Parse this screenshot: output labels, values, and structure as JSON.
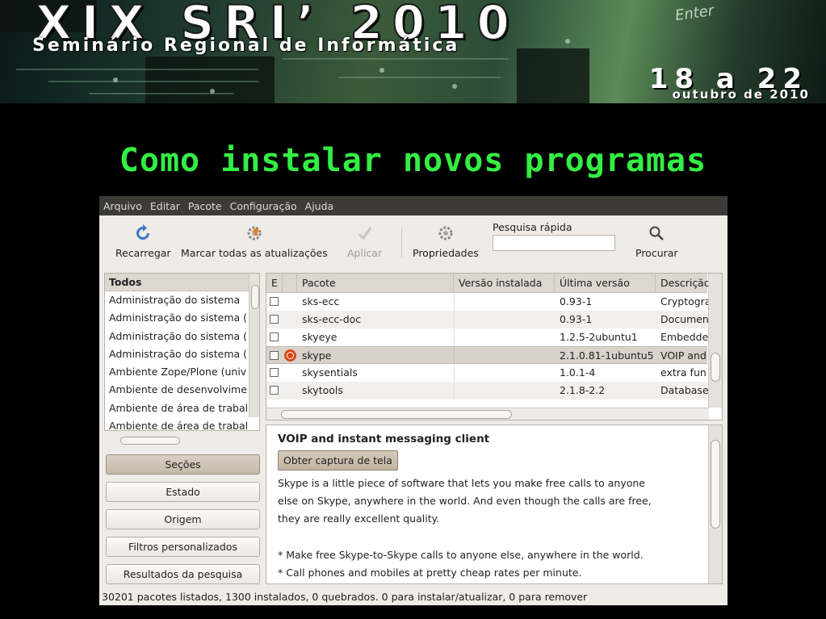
{
  "banner": {
    "title": "XIX SRI’ 2010",
    "subtitle": "Seminário Regional de Informática",
    "dates": "18 a 22",
    "month": "outubro de 2010",
    "key_label": "Enter"
  },
  "heading": "Como instalar novos programas",
  "window": {
    "menu": [
      "Arquivo",
      "Editar",
      "Pacote",
      "Configuração",
      "Ajuda"
    ],
    "toolbar": {
      "reload": "Recarregar",
      "mark_all": "Marcar todas as atualizações",
      "apply": "Aplicar",
      "properties": "Propriedades",
      "quick_search_label": "Pesquisa rápida",
      "quick_search_value": "",
      "search": "Procurar"
    },
    "categories": {
      "header": "Todos",
      "items": [
        "Administração do sistema",
        "Administração do sistema (",
        "Administração do sistema (",
        "Administração do sistema (",
        "Ambiente Zope/Plone (univ",
        "Ambiente de desenvolvime",
        "Ambiente de área de trabal",
        "Ambiente de área de trabal"
      ]
    },
    "filters": [
      "Seções",
      "Estado",
      "Origem",
      "Filtros personalizados",
      "Resultados da pesquisa"
    ],
    "packages": {
      "columns": [
        "E",
        "",
        "Pacote",
        "Versão instalada",
        "Última versão",
        "Descrição"
      ],
      "rows": [
        {
          "name": "sks-ecc",
          "installed": "",
          "latest": "0.93-1",
          "desc": "Cryptography"
        },
        {
          "name": "sks-ecc-doc",
          "installed": "",
          "latest": "0.93-1",
          "desc": "Documentation"
        },
        {
          "name": "skyeye",
          "installed": "",
          "latest": "1.2.5-2ubuntu1",
          "desc": "Embedded"
        },
        {
          "name": "skype",
          "installed": "",
          "latest": "2.1.0.81-1ubuntu5",
          "desc": "VOIP and"
        },
        {
          "name": "skysentials",
          "installed": "",
          "latest": "1.0.1-4",
          "desc": "extra fun"
        },
        {
          "name": "skytools",
          "installed": "",
          "latest": "2.1.8-2.2",
          "desc": "Database"
        }
      ]
    },
    "description": {
      "title": "VOIP and instant messaging client",
      "screenshot_button": "Obter captura de tela",
      "lines": [
        "Skype is a little piece of software that lets you make free calls to anyone",
        "else on Skype, anywhere in the world. And even though the calls are free,",
        "they are really excellent quality.",
        "",
        "* Make free Skype-to-Skype calls to anyone else, anywhere in the world.",
        "* Call phones and mobiles at pretty cheap rates per minute."
      ]
    },
    "status": "30201 pacotes listados, 1300 instalados, 0 quebrados. 0 para instalar/atualizar, 0 para remover"
  }
}
